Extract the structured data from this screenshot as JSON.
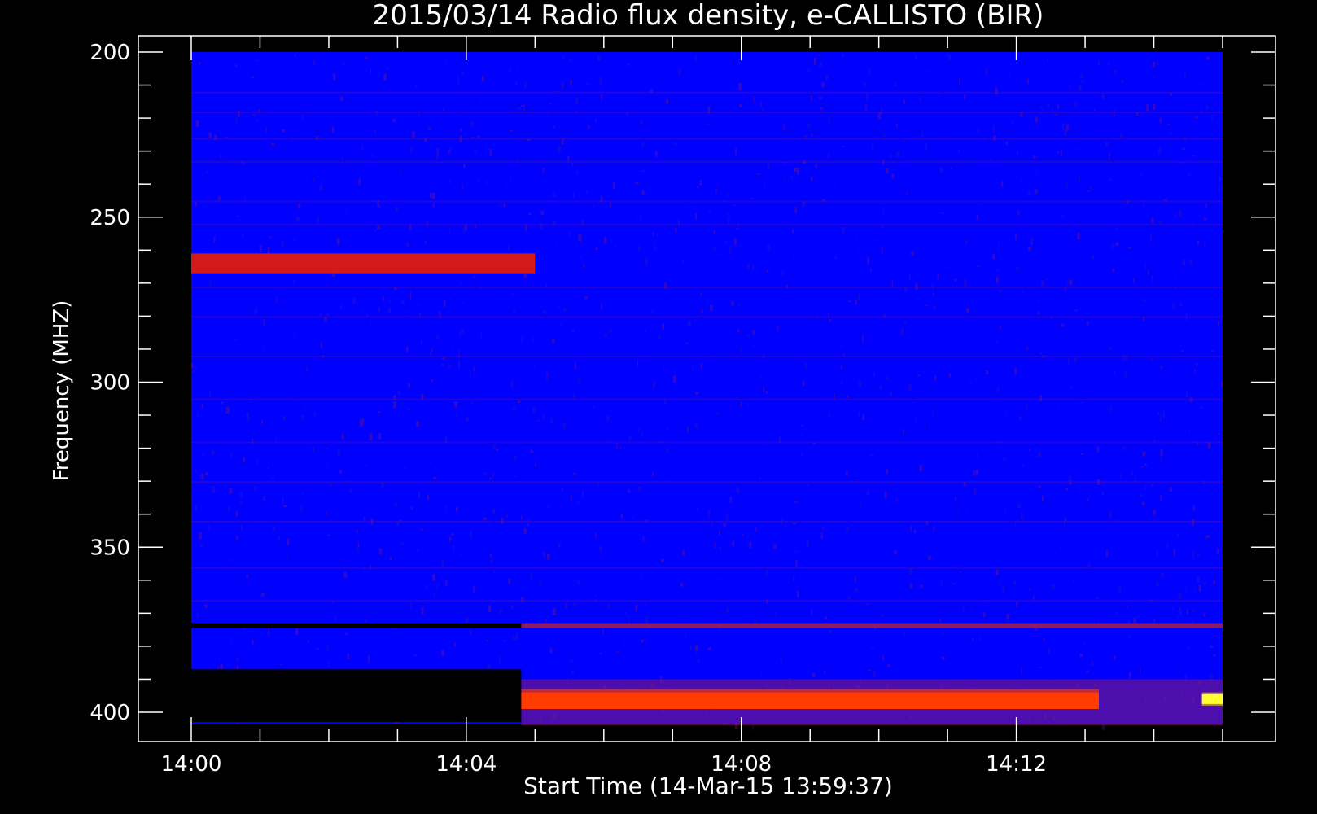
{
  "chart_data": {
    "type": "heatmap",
    "title": "2015/03/14  Radio flux density, e-CALLISTO (BIR)",
    "xlabel": "Start Time (14-Mar-15 13:59:37)",
    "ylabel": "Frequency (MHZ)",
    "x_ticks": [
      "14:00",
      "14:04",
      "14:08",
      "14:12"
    ],
    "y_ticks": [
      "200",
      "250",
      "300",
      "350",
      "400"
    ],
    "x_range_minutes": [
      0,
      15
    ],
    "y_range_mhz": [
      200,
      405
    ],
    "y_inverted": true,
    "colors": {
      "background": "#0000ff",
      "low": "#8a1c6a",
      "mid": "#d21a1a",
      "high": "#ff3b00",
      "peak": "#ffff33",
      "gap": "#000000",
      "frame": "#ffffff"
    },
    "features": [
      {
        "label": "band",
        "t0": 0,
        "t1": 5.0,
        "f0": 261,
        "f1": 267,
        "level": "mid"
      },
      {
        "label": "gap",
        "t0": 0,
        "t1": 4.8,
        "f0": 373,
        "f1": 374.5,
        "level": "gap"
      },
      {
        "label": "gap",
        "t0": 0,
        "t1": 4.8,
        "f0": 387,
        "f1": 403,
        "level": "gap"
      },
      {
        "label": "band",
        "t0": 4.8,
        "t1": 13.2,
        "f0": 393,
        "f1": 399,
        "level": "high"
      },
      {
        "label": "band",
        "t0": 4.8,
        "t1": 15,
        "f0": 373,
        "f1": 374.5,
        "level": "low"
      },
      {
        "label": "burst",
        "t0": 14.7,
        "t1": 15,
        "f0": 394,
        "f1": 398,
        "level": "peak"
      }
    ]
  }
}
